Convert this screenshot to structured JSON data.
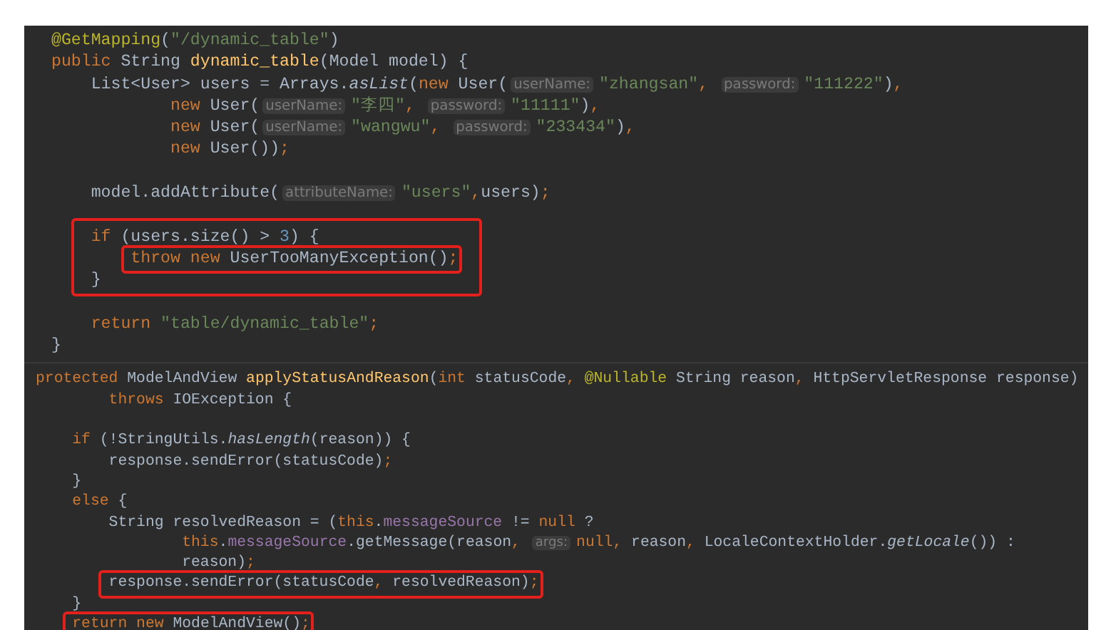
{
  "panels": [
    {
      "lines": [
        {
          "kind": "code",
          "boxed": false,
          "tokens": [
            {
              "kind": "ann",
              "text": "@GetMapping"
            },
            {
              "kind": "plain",
              "text": "("
            },
            {
              "kind": "str",
              "text": "\"/dynamic_table\""
            },
            {
              "kind": "plain",
              "text": ")"
            }
          ]
        },
        {
          "kind": "code",
          "boxed": false,
          "tokens": [
            {
              "kind": "kw",
              "text": "public "
            },
            {
              "kind": "plain",
              "text": "String "
            },
            {
              "kind": "fn",
              "text": "dynamic_table"
            },
            {
              "kind": "plain",
              "text": "(Model model) {"
            }
          ]
        },
        {
          "kind": "code",
          "boxed": false,
          "tokens": [
            {
              "kind": "plain",
              "text": "    List<User> users = Arrays."
            },
            {
              "kind": "italic",
              "text": "asList"
            },
            {
              "kind": "plain",
              "text": "("
            },
            {
              "kind": "kw",
              "text": "new "
            },
            {
              "kind": "plain",
              "text": "User("
            },
            {
              "kind": "hint",
              "text": "userName:"
            },
            {
              "kind": "str",
              "text": "\"zhangsan\""
            },
            {
              "kind": "kw",
              "text": ", "
            },
            {
              "kind": "hint",
              "text": "password:"
            },
            {
              "kind": "str",
              "text": "\"111222\""
            },
            {
              "kind": "plain",
              "text": ")"
            },
            {
              "kind": "kw",
              "text": ","
            }
          ]
        },
        {
          "kind": "code",
          "boxed": false,
          "tokens": [
            {
              "kind": "kw",
              "text": "            new "
            },
            {
              "kind": "plain",
              "text": "User("
            },
            {
              "kind": "hint",
              "text": "userName:"
            },
            {
              "kind": "str",
              "text": "\"李四\""
            },
            {
              "kind": "kw",
              "text": ", "
            },
            {
              "kind": "hint",
              "text": "password:"
            },
            {
              "kind": "str",
              "text": "\"11111\""
            },
            {
              "kind": "plain",
              "text": ")"
            },
            {
              "kind": "kw",
              "text": ","
            }
          ]
        },
        {
          "kind": "code",
          "boxed": false,
          "tokens": [
            {
              "kind": "kw",
              "text": "            new "
            },
            {
              "kind": "plain",
              "text": "User("
            },
            {
              "kind": "hint",
              "text": "userName:"
            },
            {
              "kind": "str",
              "text": "\"wangwu\""
            },
            {
              "kind": "kw",
              "text": ", "
            },
            {
              "kind": "hint",
              "text": "password:"
            },
            {
              "kind": "str",
              "text": "\"233434\""
            },
            {
              "kind": "plain",
              "text": ")"
            },
            {
              "kind": "kw",
              "text": ","
            }
          ]
        },
        {
          "kind": "code",
          "boxed": false,
          "tokens": [
            {
              "kind": "kw",
              "text": "            new "
            },
            {
              "kind": "plain",
              "text": "User())"
            },
            {
              "kind": "kw",
              "text": ";"
            }
          ]
        },
        {
          "kind": "blank"
        },
        {
          "kind": "code",
          "boxed": false,
          "tokens": [
            {
              "kind": "plain",
              "text": "    model.addAttribute("
            },
            {
              "kind": "hint",
              "text": "attributeName:"
            },
            {
              "kind": "str",
              "text": "\"users\""
            },
            {
              "kind": "kw",
              "text": ","
            },
            {
              "kind": "plain",
              "text": "users)"
            },
            {
              "kind": "kw",
              "text": ";"
            }
          ]
        },
        {
          "kind": "blank"
        },
        {
          "kind": "block",
          "boxed": true,
          "lines": [
            {
              "kind": "code",
              "boxed": false,
              "tokens": [
                {
                  "kind": "kw",
                  "text": "    if "
                },
                {
                  "kind": "plain",
                  "text": "(users.size() > "
                },
                {
                  "kind": "num",
                  "text": "3"
                },
                {
                  "kind": "plain",
                  "text": ") {"
                }
              ]
            },
            {
              "kind": "code",
              "boxed": true,
              "tokens": [
                {
                  "kind": "kw",
                  "text": "        throw new "
                },
                {
                  "kind": "plain",
                  "text": "UserTooManyException()"
                },
                {
                  "kind": "kw",
                  "text": ";"
                }
              ]
            },
            {
              "kind": "code",
              "boxed": false,
              "tokens": [
                {
                  "kind": "plain",
                  "text": "    }"
                }
              ]
            }
          ]
        },
        {
          "kind": "blank"
        },
        {
          "kind": "code",
          "boxed": false,
          "tokens": [
            {
              "kind": "kw",
              "text": "    return "
            },
            {
              "kind": "str",
              "text": "\"table/dynamic_table\""
            },
            {
              "kind": "kw",
              "text": ";"
            }
          ]
        },
        {
          "kind": "code",
          "boxed": false,
          "tokens": [
            {
              "kind": "plain",
              "text": "}"
            }
          ]
        }
      ]
    },
    {
      "lines": [
        {
          "kind": "code",
          "boxed": false,
          "tokens": [
            {
              "kind": "kw",
              "text": "protected "
            },
            {
              "kind": "plain",
              "text": "ModelAndView "
            },
            {
              "kind": "fn",
              "text": "applyStatusAndReason"
            },
            {
              "kind": "plain",
              "text": "("
            },
            {
              "kind": "kw",
              "text": "int "
            },
            {
              "kind": "plain",
              "text": "statusCode"
            },
            {
              "kind": "kw",
              "text": ", "
            },
            {
              "kind": "ann",
              "text": "@Nullable "
            },
            {
              "kind": "plain",
              "text": "String reason"
            },
            {
              "kind": "kw",
              "text": ", "
            },
            {
              "kind": "plain",
              "text": "HttpServletResponse response)"
            }
          ]
        },
        {
          "kind": "code",
          "boxed": false,
          "tokens": [
            {
              "kind": "kw",
              "text": "        throws "
            },
            {
              "kind": "plain",
              "text": "IOException {"
            }
          ]
        },
        {
          "kind": "blank"
        },
        {
          "kind": "code",
          "boxed": false,
          "tokens": [
            {
              "kind": "kw",
              "text": "    if "
            },
            {
              "kind": "plain",
              "text": "(!StringUtils."
            },
            {
              "kind": "italic",
              "text": "hasLength"
            },
            {
              "kind": "plain",
              "text": "(reason)) {"
            }
          ]
        },
        {
          "kind": "code",
          "boxed": false,
          "tokens": [
            {
              "kind": "plain",
              "text": "        response.sendError(statusCode)"
            },
            {
              "kind": "kw",
              "text": ";"
            }
          ]
        },
        {
          "kind": "code",
          "boxed": false,
          "tokens": [
            {
              "kind": "plain",
              "text": "    }"
            }
          ]
        },
        {
          "kind": "code",
          "boxed": false,
          "tokens": [
            {
              "kind": "kw",
              "text": "    else "
            },
            {
              "kind": "plain",
              "text": "{"
            }
          ]
        },
        {
          "kind": "code",
          "boxed": false,
          "tokens": [
            {
              "kind": "plain",
              "text": "        String resolvedReason = ("
            },
            {
              "kind": "kw",
              "text": "this"
            },
            {
              "kind": "plain",
              "text": "."
            },
            {
              "kind": "field",
              "text": "messageSource"
            },
            {
              "kind": "plain",
              "text": " != "
            },
            {
              "kind": "kw",
              "text": "null"
            },
            {
              "kind": "plain",
              "text": " ?"
            }
          ]
        },
        {
          "kind": "code",
          "boxed": false,
          "tokens": [
            {
              "kind": "kw",
              "text": "                this"
            },
            {
              "kind": "plain",
              "text": "."
            },
            {
              "kind": "field",
              "text": "messageSource"
            },
            {
              "kind": "plain",
              "text": ".getMessage(reason"
            },
            {
              "kind": "kw",
              "text": ", "
            },
            {
              "kind": "hint",
              "text": "args:"
            },
            {
              "kind": "kw",
              "text": "null, "
            },
            {
              "kind": "plain",
              "text": "reason"
            },
            {
              "kind": "kw",
              "text": ", "
            },
            {
              "kind": "plain",
              "text": "LocaleContextHolder."
            },
            {
              "kind": "italic",
              "text": "getLocale"
            },
            {
              "kind": "plain",
              "text": "()) :"
            }
          ]
        },
        {
          "kind": "code",
          "boxed": false,
          "tokens": [
            {
              "kind": "plain",
              "text": "                reason)"
            },
            {
              "kind": "kw",
              "text": ";"
            }
          ]
        },
        {
          "kind": "code",
          "boxed": true,
          "tokens": [
            {
              "kind": "plain",
              "text": "        response.sendError(statusCode"
            },
            {
              "kind": "kw",
              "text": ", "
            },
            {
              "kind": "plain",
              "text": "resolvedReason)"
            },
            {
              "kind": "kw",
              "text": ";"
            }
          ]
        },
        {
          "kind": "code",
          "boxed": false,
          "tokens": [
            {
              "kind": "plain",
              "text": "    }"
            }
          ]
        },
        {
          "kind": "code",
          "boxed": true,
          "tokens": [
            {
              "kind": "kw",
              "text": "    return new "
            },
            {
              "kind": "plain",
              "text": "ModelAndView()"
            },
            {
              "kind": "kw",
              "text": ";"
            }
          ]
        }
      ]
    }
  ]
}
